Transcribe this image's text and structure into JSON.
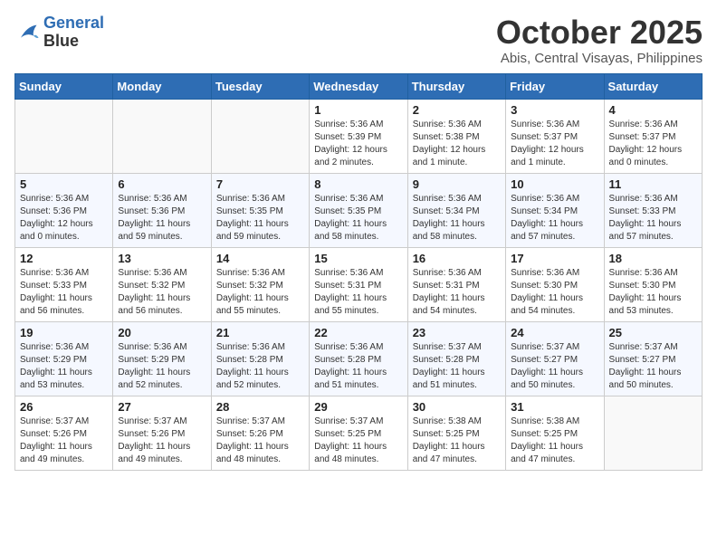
{
  "logo": {
    "line1": "General",
    "line2": "Blue"
  },
  "title": "October 2025",
  "location": "Abis, Central Visayas, Philippines",
  "weekdays": [
    "Sunday",
    "Monday",
    "Tuesday",
    "Wednesday",
    "Thursday",
    "Friday",
    "Saturday"
  ],
  "weeks": [
    [
      {
        "day": "",
        "sunrise": "",
        "sunset": "",
        "daylight": ""
      },
      {
        "day": "",
        "sunrise": "",
        "sunset": "",
        "daylight": ""
      },
      {
        "day": "",
        "sunrise": "",
        "sunset": "",
        "daylight": ""
      },
      {
        "day": "1",
        "sunrise": "Sunrise: 5:36 AM",
        "sunset": "Sunset: 5:39 PM",
        "daylight": "Daylight: 12 hours and 2 minutes."
      },
      {
        "day": "2",
        "sunrise": "Sunrise: 5:36 AM",
        "sunset": "Sunset: 5:38 PM",
        "daylight": "Daylight: 12 hours and 1 minute."
      },
      {
        "day": "3",
        "sunrise": "Sunrise: 5:36 AM",
        "sunset": "Sunset: 5:37 PM",
        "daylight": "Daylight: 12 hours and 1 minute."
      },
      {
        "day": "4",
        "sunrise": "Sunrise: 5:36 AM",
        "sunset": "Sunset: 5:37 PM",
        "daylight": "Daylight: 12 hours and 0 minutes."
      }
    ],
    [
      {
        "day": "5",
        "sunrise": "Sunrise: 5:36 AM",
        "sunset": "Sunset: 5:36 PM",
        "daylight": "Daylight: 12 hours and 0 minutes."
      },
      {
        "day": "6",
        "sunrise": "Sunrise: 5:36 AM",
        "sunset": "Sunset: 5:36 PM",
        "daylight": "Daylight: 11 hours and 59 minutes."
      },
      {
        "day": "7",
        "sunrise": "Sunrise: 5:36 AM",
        "sunset": "Sunset: 5:35 PM",
        "daylight": "Daylight: 11 hours and 59 minutes."
      },
      {
        "day": "8",
        "sunrise": "Sunrise: 5:36 AM",
        "sunset": "Sunset: 5:35 PM",
        "daylight": "Daylight: 11 hours and 58 minutes."
      },
      {
        "day": "9",
        "sunrise": "Sunrise: 5:36 AM",
        "sunset": "Sunset: 5:34 PM",
        "daylight": "Daylight: 11 hours and 58 minutes."
      },
      {
        "day": "10",
        "sunrise": "Sunrise: 5:36 AM",
        "sunset": "Sunset: 5:34 PM",
        "daylight": "Daylight: 11 hours and 57 minutes."
      },
      {
        "day": "11",
        "sunrise": "Sunrise: 5:36 AM",
        "sunset": "Sunset: 5:33 PM",
        "daylight": "Daylight: 11 hours and 57 minutes."
      }
    ],
    [
      {
        "day": "12",
        "sunrise": "Sunrise: 5:36 AM",
        "sunset": "Sunset: 5:33 PM",
        "daylight": "Daylight: 11 hours and 56 minutes."
      },
      {
        "day": "13",
        "sunrise": "Sunrise: 5:36 AM",
        "sunset": "Sunset: 5:32 PM",
        "daylight": "Daylight: 11 hours and 56 minutes."
      },
      {
        "day": "14",
        "sunrise": "Sunrise: 5:36 AM",
        "sunset": "Sunset: 5:32 PM",
        "daylight": "Daylight: 11 hours and 55 minutes."
      },
      {
        "day": "15",
        "sunrise": "Sunrise: 5:36 AM",
        "sunset": "Sunset: 5:31 PM",
        "daylight": "Daylight: 11 hours and 55 minutes."
      },
      {
        "day": "16",
        "sunrise": "Sunrise: 5:36 AM",
        "sunset": "Sunset: 5:31 PM",
        "daylight": "Daylight: 11 hours and 54 minutes."
      },
      {
        "day": "17",
        "sunrise": "Sunrise: 5:36 AM",
        "sunset": "Sunset: 5:30 PM",
        "daylight": "Daylight: 11 hours and 54 minutes."
      },
      {
        "day": "18",
        "sunrise": "Sunrise: 5:36 AM",
        "sunset": "Sunset: 5:30 PM",
        "daylight": "Daylight: 11 hours and 53 minutes."
      }
    ],
    [
      {
        "day": "19",
        "sunrise": "Sunrise: 5:36 AM",
        "sunset": "Sunset: 5:29 PM",
        "daylight": "Daylight: 11 hours and 53 minutes."
      },
      {
        "day": "20",
        "sunrise": "Sunrise: 5:36 AM",
        "sunset": "Sunset: 5:29 PM",
        "daylight": "Daylight: 11 hours and 52 minutes."
      },
      {
        "day": "21",
        "sunrise": "Sunrise: 5:36 AM",
        "sunset": "Sunset: 5:28 PM",
        "daylight": "Daylight: 11 hours and 52 minutes."
      },
      {
        "day": "22",
        "sunrise": "Sunrise: 5:36 AM",
        "sunset": "Sunset: 5:28 PM",
        "daylight": "Daylight: 11 hours and 51 minutes."
      },
      {
        "day": "23",
        "sunrise": "Sunrise: 5:37 AM",
        "sunset": "Sunset: 5:28 PM",
        "daylight": "Daylight: 11 hours and 51 minutes."
      },
      {
        "day": "24",
        "sunrise": "Sunrise: 5:37 AM",
        "sunset": "Sunset: 5:27 PM",
        "daylight": "Daylight: 11 hours and 50 minutes."
      },
      {
        "day": "25",
        "sunrise": "Sunrise: 5:37 AM",
        "sunset": "Sunset: 5:27 PM",
        "daylight": "Daylight: 11 hours and 50 minutes."
      }
    ],
    [
      {
        "day": "26",
        "sunrise": "Sunrise: 5:37 AM",
        "sunset": "Sunset: 5:26 PM",
        "daylight": "Daylight: 11 hours and 49 minutes."
      },
      {
        "day": "27",
        "sunrise": "Sunrise: 5:37 AM",
        "sunset": "Sunset: 5:26 PM",
        "daylight": "Daylight: 11 hours and 49 minutes."
      },
      {
        "day": "28",
        "sunrise": "Sunrise: 5:37 AM",
        "sunset": "Sunset: 5:26 PM",
        "daylight": "Daylight: 11 hours and 48 minutes."
      },
      {
        "day": "29",
        "sunrise": "Sunrise: 5:37 AM",
        "sunset": "Sunset: 5:25 PM",
        "daylight": "Daylight: 11 hours and 48 minutes."
      },
      {
        "day": "30",
        "sunrise": "Sunrise: 5:38 AM",
        "sunset": "Sunset: 5:25 PM",
        "daylight": "Daylight: 11 hours and 47 minutes."
      },
      {
        "day": "31",
        "sunrise": "Sunrise: 5:38 AM",
        "sunset": "Sunset: 5:25 PM",
        "daylight": "Daylight: 11 hours and 47 minutes."
      },
      {
        "day": "",
        "sunrise": "",
        "sunset": "",
        "daylight": ""
      }
    ]
  ]
}
